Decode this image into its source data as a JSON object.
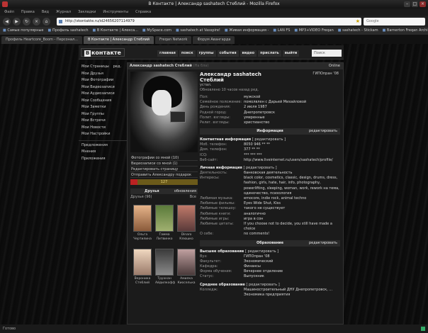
{
  "window": {
    "title": "В Контакте | Александр sashatech Стеблий - Mozilla Firefox"
  },
  "menubar": [
    "Файл",
    "Правка",
    "Вид",
    "Журнал",
    "Закладки",
    "Инструменты",
    "Справка"
  ],
  "navbar": {
    "url": "http://vkontakte.ru/id24656207114979",
    "search_placeholder": "Google"
  },
  "bookmarks": [
    "Самые популярные",
    "Профиль sashatech",
    "В Контакте | Алекса...",
    "MySpace.com",
    "sashatech at Vasspire!",
    "Живая информация -",
    "LAN FS",
    "MP3+VIDEO Freqan",
    "sashatech - Stickam",
    "Barnerton Freqan Archi..."
  ],
  "tabs": [
    {
      "label": "Профиль Heartcore_Boom - Персонал...",
      "active": false
    },
    {
      "label": "В Контакте | Александр Стеблий",
      "active": true
    },
    {
      "label": "Freqan Network",
      "active": false
    },
    {
      "label": "Форум Авангарда",
      "active": false
    }
  ],
  "vk": {
    "logo": "контакте",
    "logo_letter": "В",
    "topnav": [
      "главная",
      "поиск",
      "группы",
      "события",
      "видео",
      "прислать",
      "выйти"
    ],
    "search_placeholder": "Поиск",
    "leftmenu": [
      "Мои Страницы",
      "Мои Друзья",
      "Мои Фотографии",
      "Мои Видеозаписи",
      "Мои Аудиозаписи",
      "Мои Сообщения",
      "Мои Заметки",
      "Мои Группы",
      "Мои Встречи",
      "Мои Новости",
      "Мои Настройки"
    ],
    "leftmenu_edit": "ред.",
    "leftmenu_extra": [
      "Предложения",
      "Мнения",
      "Приложения"
    ],
    "profile_bar": {
      "name": "Александр sashatech Стеблий",
      "status": "(На бла)",
      "online": "Online"
    },
    "actions": [
      "Фотографии со мной (10)",
      "Видеозаписи со мной (1)",
      "Редактировать страницу",
      "Отправить Александру подарок"
    ],
    "rating": {
      "value": "127",
      "fraction": 0.1
    },
    "friends": {
      "title": "Друзья",
      "edit": "обновления",
      "sub": "Друзья (96)",
      "all": "Все",
      "list": [
        {
          "name": "Ольга Чертилина"
        },
        {
          "name": "Гамма Литвинко"
        },
        {
          "name": "Dinaro Клюшко"
        },
        {
          "name": "Вероника Стеблий"
        },
        {
          "name": "Трухнан Айдилкофф"
        },
        {
          "name": "Амилка Киоселька"
        }
      ]
    },
    "info": {
      "name": "Александр sashatech",
      "surname": "Стеблий",
      "university": "ГИПОпран '08",
      "status_label": "устал.",
      "updated": "Обновлено 10 часов назад ред.",
      "basic": [
        [
          "Пол:",
          "мужской"
        ],
        [
          "Семейное положение:",
          "помолвлен с Дарьей Михайловой"
        ],
        [
          "День рождения:",
          "2 июля 1987"
        ],
        [
          "Родной город:",
          "Днепропетровск"
        ],
        [
          "Полит. взгляды:",
          "умеренные"
        ],
        [
          "Религ. взгляды:",
          "христианство"
        ]
      ],
      "info_head": "Информация",
      "edit": "редактировать",
      "contact_head": "Контактная информация",
      "contact_edit": "[ редактировать ]",
      "contact": [
        [
          "Моб. телефон:",
          "8050 946 ** **"
        ],
        [
          "Дом. телефон:",
          "377 ** **"
        ],
        [
          "ICQ:",
          "*** *** ***"
        ],
        [
          "Веб-сайт:",
          "http://www.liveinternet.ru/users/sashatech/profile/"
        ]
      ],
      "personal_head": "Личная информация",
      "personal_edit": "[ редактировать ]",
      "personal": [
        [
          "Деятельность:",
          "банковская деятельность"
        ],
        [
          "Интересы:",
          "black color, cosmetics, classic, design, drums, dress, fashion, girls, hate, hair, info, photography, powerlifting, sleeping, woman, work, rework на тема, одиночество, психология"
        ],
        [
          "Любимая музыка:",
          "emocore, indie rock, animal techno"
        ],
        [
          "Любимые фильмы:",
          "Eyes Wide Shut, Kiss"
        ],
        [
          "Любимые телешоу:",
          "такого не существует"
        ],
        [
          "Любимые книги:",
          "аналогично"
        ],
        [
          "Любимые игры:",
          "игра в сон"
        ],
        [
          "Любимые цитаты:",
          "If you choose not to decide, you still have made a choice"
        ],
        [
          "О себе:",
          "no comments!"
        ]
      ],
      "edu_head": "Образование",
      "higher_head": "Высшее образование",
      "higher_edit": "[ редактировать ]",
      "higher": [
        [
          "Вуз:",
          "ГИПОпран '08"
        ],
        [
          "Факультет:",
          "Экономический"
        ],
        [
          "Кафедра:",
          "Финансы"
        ],
        [
          "Форма обучения:",
          "Вечернее отделение"
        ],
        [
          "Статус:",
          "Выпускник"
        ]
      ],
      "secondary_head": "Среднее образование",
      "secondary_edit": "[ редактировать ]",
      "secondary": [
        [
          "Колледж:",
          "Машиностроительный ДНУ Днепропетровск, ... Экономика предприятия"
        ]
      ]
    }
  },
  "statusbar": {
    "text": "Готово"
  }
}
